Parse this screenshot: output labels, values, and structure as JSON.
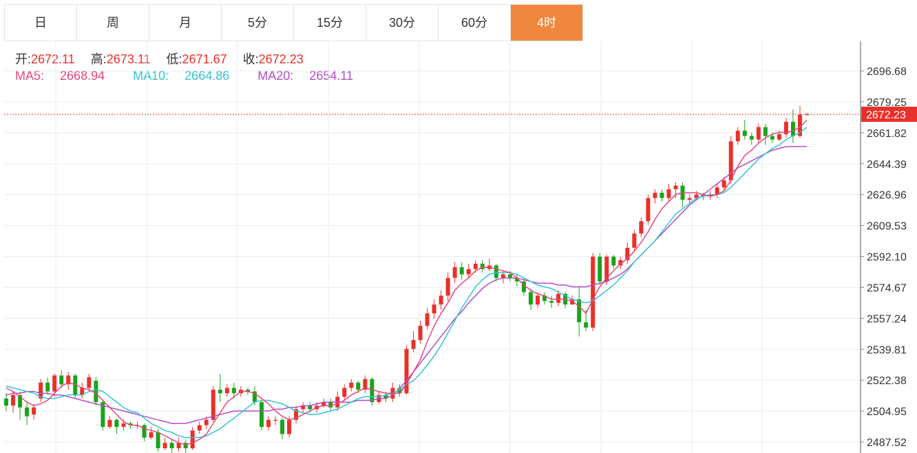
{
  "periods": [
    {
      "label": "日",
      "active": false
    },
    {
      "label": "周",
      "active": false
    },
    {
      "label": "月",
      "active": false
    },
    {
      "label": "5分",
      "active": false
    },
    {
      "label": "15分",
      "active": false
    },
    {
      "label": "30分",
      "active": false
    },
    {
      "label": "60分",
      "active": false
    },
    {
      "label": "4时",
      "active": true
    }
  ],
  "ohlc": {
    "open_label": "开:",
    "open": "2672.11",
    "high_label": "高:",
    "high": "2673.11",
    "low_label": "低:",
    "low": "2671.67",
    "close_label": "收:",
    "close": "2672.23"
  },
  "ma": {
    "ma5_label": "MA5:",
    "ma5": "2668.94",
    "ma10_label": "MA10:",
    "ma10": "2664.86",
    "ma20_label": "MA20:",
    "ma20": "2654.11"
  },
  "colors": {
    "up": "#e8312a",
    "down": "#1aa31a",
    "ma5": "#e8457a",
    "ma10": "#33c3d0",
    "ma20": "#b44bc7",
    "accent": "#f0873e"
  },
  "chart_data": {
    "type": "candlestick",
    "y_ticks": [
      "2696.68",
      "2679.25",
      "2661.82",
      "2644.39",
      "2626.96",
      "2609.53",
      "2592.10",
      "2574.67",
      "2557.24",
      "2539.81",
      "2522.38",
      "2504.95",
      "2487.52"
    ],
    "ylim": [
      2487.52,
      2696.68
    ],
    "last_price": "2672.23",
    "grid": true,
    "candles": [
      [
        2512,
        2508,
        2515,
        2505
      ],
      [
        2508,
        2514,
        2516,
        2504
      ],
      [
        2514,
        2507,
        2516,
        2500
      ],
      [
        2507,
        2502,
        2510,
        2497
      ],
      [
        2503,
        2507,
        2509,
        2500
      ],
      [
        2512,
        2521,
        2523,
        2510
      ],
      [
        2521,
        2516,
        2524,
        2514
      ],
      [
        2516,
        2525,
        2526,
        2513
      ],
      [
        2525,
        2520,
        2528,
        2518
      ],
      [
        2520,
        2525,
        2527,
        2517
      ],
      [
        2525,
        2514,
        2526,
        2512
      ],
      [
        2514,
        2518,
        2521,
        2512
      ],
      [
        2518,
        2524,
        2526,
        2516
      ],
      [
        2522,
        2510,
        2524,
        2508
      ],
      [
        2510,
        2496,
        2511,
        2494
      ],
      [
        2496,
        2500,
        2502,
        2495
      ],
      [
        2500,
        2496,
        2501,
        2492
      ],
      [
        2496,
        2498,
        2500,
        2494
      ],
      [
        2498,
        2497,
        2499,
        2495
      ],
      [
        2497,
        2497,
        2499,
        2495
      ],
      [
        2497,
        2490,
        2498,
        2488
      ],
      [
        2490,
        2493,
        2496,
        2489
      ],
      [
        2493,
        2484,
        2495,
        2482
      ],
      [
        2484,
        2487,
        2490,
        2483
      ],
      [
        2487,
        2484,
        2489,
        2481
      ],
      [
        2484,
        2487,
        2490,
        2482
      ],
      [
        2487,
        2484,
        2489,
        2480
      ],
      [
        2484,
        2494,
        2496,
        2483
      ],
      [
        2494,
        2497,
        2499,
        2492
      ],
      [
        2497,
        2500,
        2502,
        2495
      ],
      [
        2500,
        2517,
        2519,
        2499
      ],
      [
        2517,
        2515,
        2526,
        2510
      ],
      [
        2515,
        2518,
        2520,
        2513
      ],
      [
        2518,
        2515,
        2521,
        2512
      ],
      [
        2515,
        2517,
        2519,
        2513
      ],
      [
        2517,
        2516,
        2518,
        2514
      ],
      [
        2516,
        2510,
        2519,
        2508
      ],
      [
        2510,
        2496,
        2511,
        2494
      ],
      [
        2496,
        2500,
        2502,
        2494
      ],
      [
        2500,
        2500,
        2502,
        2497
      ],
      [
        2500,
        2492,
        2501,
        2489
      ],
      [
        2492,
        2500,
        2502,
        2490
      ],
      [
        2500,
        2506,
        2508,
        2498
      ],
      [
        2506,
        2508,
        2510,
        2504
      ],
      [
        2508,
        2506,
        2510,
        2504
      ],
      [
        2506,
        2508,
        2510,
        2504
      ],
      [
        2508,
        2510,
        2512,
        2507
      ],
      [
        2510,
        2507,
        2512,
        2505
      ],
      [
        2507,
        2513,
        2516,
        2505
      ],
      [
        2513,
        2518,
        2520,
        2511
      ],
      [
        2518,
        2521,
        2523,
        2516
      ],
      [
        2521,
        2517,
        2522,
        2515
      ],
      [
        2517,
        2523,
        2525,
        2515
      ],
      [
        2523,
        2510,
        2524,
        2508
      ],
      [
        2510,
        2514,
        2516,
        2509
      ],
      [
        2514,
        2512,
        2516,
        2510
      ],
      [
        2512,
        2518,
        2521,
        2510
      ],
      [
        2518,
        2515,
        2520,
        2513
      ],
      [
        2515,
        2540,
        2542,
        2514
      ],
      [
        2540,
        2545,
        2550,
        2538
      ],
      [
        2545,
        2553,
        2556,
        2543
      ],
      [
        2553,
        2560,
        2563,
        2551
      ],
      [
        2560,
        2565,
        2568,
        2557
      ],
      [
        2565,
        2570,
        2573,
        2562
      ],
      [
        2570,
        2580,
        2583,
        2567
      ],
      [
        2580,
        2586,
        2589,
        2577
      ],
      [
        2586,
        2582,
        2589,
        2579
      ],
      [
        2582,
        2585,
        2588,
        2580
      ],
      [
        2585,
        2588,
        2590,
        2583
      ],
      [
        2588,
        2585,
        2590,
        2583
      ],
      [
        2585,
        2587,
        2591,
        2584
      ],
      [
        2587,
        2580,
        2588,
        2578
      ],
      [
        2580,
        2582,
        2584,
        2577
      ],
      [
        2582,
        2580,
        2584,
        2578
      ],
      [
        2580,
        2578,
        2582,
        2575
      ],
      [
        2578,
        2572,
        2580,
        2570
      ],
      [
        2572,
        2565,
        2574,
        2562
      ],
      [
        2565,
        2570,
        2572,
        2563
      ],
      [
        2570,
        2567,
        2572,
        2565
      ],
      [
        2567,
        2566,
        2570,
        2563
      ],
      [
        2566,
        2571,
        2573,
        2564
      ],
      [
        2571,
        2565,
        2572,
        2563
      ],
      [
        2565,
        2568,
        2570,
        2565
      ],
      [
        2568,
        2555,
        2575,
        2547
      ],
      [
        2555,
        2552,
        2562,
        2550
      ],
      [
        2552,
        2592,
        2594,
        2550
      ],
      [
        2592,
        2578,
        2594,
        2576
      ],
      [
        2578,
        2592,
        2593,
        2576
      ],
      [
        2592,
        2587,
        2593,
        2585
      ],
      [
        2587,
        2590,
        2592,
        2585
      ],
      [
        2590,
        2597,
        2600,
        2588
      ],
      [
        2597,
        2605,
        2607,
        2595
      ],
      [
        2605,
        2612,
        2614,
        2603
      ],
      [
        2612,
        2625,
        2627,
        2610
      ],
      [
        2625,
        2628,
        2630,
        2622
      ],
      [
        2628,
        2625,
        2630,
        2623
      ],
      [
        2625,
        2630,
        2633,
        2623
      ],
      [
        2630,
        2632,
        2634,
        2625
      ],
      [
        2632,
        2624,
        2634,
        2620
      ],
      [
        2624,
        2625,
        2627,
        2622
      ],
      [
        2625,
        2627,
        2629,
        2624
      ],
      [
        2627,
        2626,
        2628,
        2624
      ],
      [
        2626,
        2627,
        2629,
        2624
      ],
      [
        2627,
        2631,
        2633,
        2625
      ],
      [
        2631,
        2635,
        2637,
        2629
      ],
      [
        2635,
        2657,
        2660,
        2633
      ],
      [
        2657,
        2663,
        2665,
        2655
      ],
      [
        2663,
        2660,
        2669,
        2658
      ],
      [
        2660,
        2658,
        2662,
        2655
      ],
      [
        2658,
        2665,
        2667,
        2656
      ],
      [
        2665,
        2660,
        2667,
        2655
      ],
      [
        2660,
        2658,
        2662,
        2656
      ],
      [
        2658,
        2661,
        2663,
        2657
      ],
      [
        2661,
        2668,
        2670,
        2659
      ],
      [
        2668,
        2660,
        2675,
        2656
      ],
      [
        2660,
        2672,
        2677,
        2659
      ],
      [
        2672.11,
        2672.23,
        2673.11,
        2671.67
      ]
    ],
    "ma5": [
      2518,
      2516,
      2513,
      2510,
      2508,
      2509,
      2511,
      2515,
      2519,
      2521,
      2520,
      2518,
      2517,
      2515,
      2511,
      2507,
      2503,
      2499,
      2497,
      2497,
      2495,
      2494,
      2493,
      2491,
      2489,
      2487,
      2486,
      2487,
      2489,
      2492,
      2498,
      2504,
      2510,
      2513,
      2516,
      2516,
      2515,
      2512,
      2509,
      2505,
      2502,
      2500,
      2501,
      2503,
      2505,
      2507,
      2508,
      2508,
      2509,
      2511,
      2514,
      2516,
      2518,
      2517,
      2516,
      2515,
      2515,
      2515,
      2520,
      2527,
      2534,
      2544,
      2553,
      2560,
      2566,
      2573,
      2577,
      2580,
      2584,
      2586,
      2586,
      2585,
      2584,
      2583,
      2580,
      2576,
      2573,
      2571,
      2570,
      2568,
      2568,
      2568,
      2567,
      2564,
      2560,
      2568,
      2575,
      2580,
      2584,
      2588,
      2591,
      2595,
      2600,
      2606,
      2613,
      2619,
      2623,
      2627,
      2628,
      2628,
      2628,
      2627,
      2626,
      2627,
      2629,
      2635,
      2643,
      2649,
      2652,
      2656,
      2659,
      2661,
      2662,
      2662,
      2663,
      2665,
      2668.94
    ],
    "ma10": [
      2519,
      2518,
      2517,
      2516,
      2515,
      2513,
      2512,
      2512,
      2513,
      2514,
      2514,
      2514,
      2516,
      2517,
      2516,
      2513,
      2510,
      2507,
      2505,
      2504,
      2501,
      2498,
      2496,
      2494,
      2493,
      2491,
      2490,
      2490,
      2490,
      2491,
      2493,
      2495,
      2498,
      2501,
      2504,
      2507,
      2510,
      2511,
      2511,
      2510,
      2509,
      2507,
      2505,
      2504,
      2503,
      2503,
      2504,
      2505,
      2506,
      2508,
      2510,
      2512,
      2513,
      2513,
      2513,
      2514,
      2515,
      2517,
      2520,
      2522,
      2526,
      2531,
      2536,
      2542,
      2549,
      2556,
      2563,
      2569,
      2575,
      2579,
      2582,
      2583,
      2583,
      2583,
      2582,
      2580,
      2578,
      2576,
      2575,
      2574,
      2572,
      2570,
      2568,
      2567,
      2566,
      2567,
      2570,
      2573,
      2576,
      2580,
      2584,
      2589,
      2593,
      2597,
      2601,
      2606,
      2611,
      2616,
      2619,
      2622,
      2625,
      2626,
      2627,
      2627,
      2628,
      2631,
      2635,
      2639,
      2643,
      2647,
      2650,
      2653,
      2655,
      2658,
      2660,
      2662,
      2664.86
    ],
    "ma20": [
      2514,
      2515,
      2515,
      2516,
      2516,
      2515,
      2515,
      2514,
      2514,
      2513,
      2512,
      2511,
      2510,
      2509,
      2508,
      2507,
      2506,
      2505,
      2504,
      2503,
      2502,
      2501,
      2500,
      2499,
      2498,
      2498,
      2498,
      2499,
      2500,
      2501,
      2502,
      2503,
      2504,
      2505,
      2505,
      2505,
      2505,
      2505,
      2505,
      2506,
      2506,
      2507,
      2507,
      2508,
      2508,
      2509,
      2510,
      2510,
      2510,
      2510,
      2510,
      2511,
      2511,
      2511,
      2512,
      2512,
      2514,
      2518,
      2522,
      2527,
      2532,
      2537,
      2542,
      2547,
      2552,
      2557,
      2561,
      2566,
      2570,
      2574,
      2577,
      2579,
      2580,
      2580,
      2580,
      2579,
      2578,
      2577,
      2577,
      2577,
      2576,
      2576,
      2575,
      2575,
      2575,
      2576,
      2577,
      2578,
      2580,
      2582,
      2585,
      2589,
      2593,
      2597,
      2601,
      2605,
      2609,
      2613,
      2617,
      2621,
      2624,
      2627,
      2630,
      2633,
      2636,
      2639,
      2642,
      2644,
      2646,
      2648,
      2650,
      2652,
      2653,
      2654,
      2654.11,
      2654.11,
      2654.11
    ]
  }
}
